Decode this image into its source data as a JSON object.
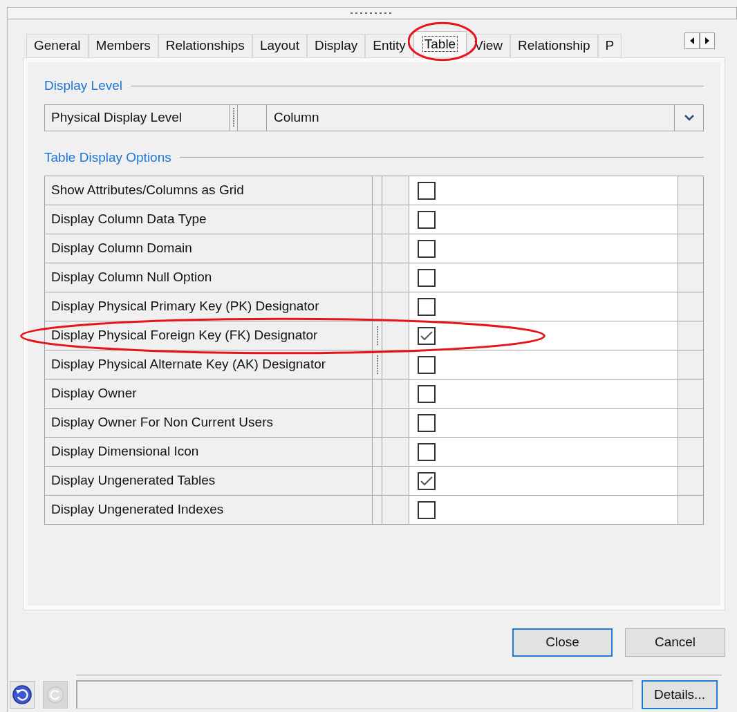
{
  "tabs": [
    {
      "label": "General",
      "selected": false,
      "circled": false
    },
    {
      "label": "Members",
      "selected": false,
      "circled": false
    },
    {
      "label": "Relationships",
      "selected": false,
      "circled": false
    },
    {
      "label": "Layout",
      "selected": false,
      "circled": false
    },
    {
      "label": "Display",
      "selected": false,
      "circled": false
    },
    {
      "label": "Entity",
      "selected": false,
      "circled": false
    },
    {
      "label": "Table",
      "selected": true,
      "circled": true
    },
    {
      "label": "View",
      "selected": false,
      "circled": false
    },
    {
      "label": "Relationship",
      "selected": false,
      "circled": false
    },
    {
      "label": "P",
      "selected": false,
      "circled": false
    }
  ],
  "display_level": {
    "title": "Display Level",
    "label": "Physical Display Level",
    "value": "Column"
  },
  "table_options": {
    "title": "Table Display Options",
    "rows": [
      {
        "label": "Show Attributes/Columns as Grid",
        "checked": false,
        "circled": false
      },
      {
        "label": "Display Column Data Type",
        "checked": false,
        "circled": false
      },
      {
        "label": "Display Column Domain",
        "checked": false,
        "circled": false
      },
      {
        "label": "Display Column Null Option",
        "checked": false,
        "circled": false
      },
      {
        "label": "Display Physical Primary Key (PK) Designator",
        "checked": false,
        "circled": false
      },
      {
        "label": "Display Physical Foreign Key (FK) Designator",
        "checked": true,
        "circled": true
      },
      {
        "label": "Display Physical Alternate Key (AK) Designator",
        "checked": false,
        "circled": false
      },
      {
        "label": "Display Owner",
        "checked": false,
        "circled": false
      },
      {
        "label": "Display Owner For Non Current Users",
        "checked": false,
        "circled": false
      },
      {
        "label": "Display Dimensional Icon",
        "checked": false,
        "circled": false
      },
      {
        "label": "Display Ungenerated Tables",
        "checked": true,
        "circled": false
      },
      {
        "label": "Display Ungenerated Indexes",
        "checked": false,
        "circled": false
      }
    ]
  },
  "buttons": [
    {
      "label": "Close",
      "focused": true
    },
    {
      "label": "Cancel",
      "focused": false
    }
  ],
  "status_bar": {
    "details_button": "Details..."
  }
}
